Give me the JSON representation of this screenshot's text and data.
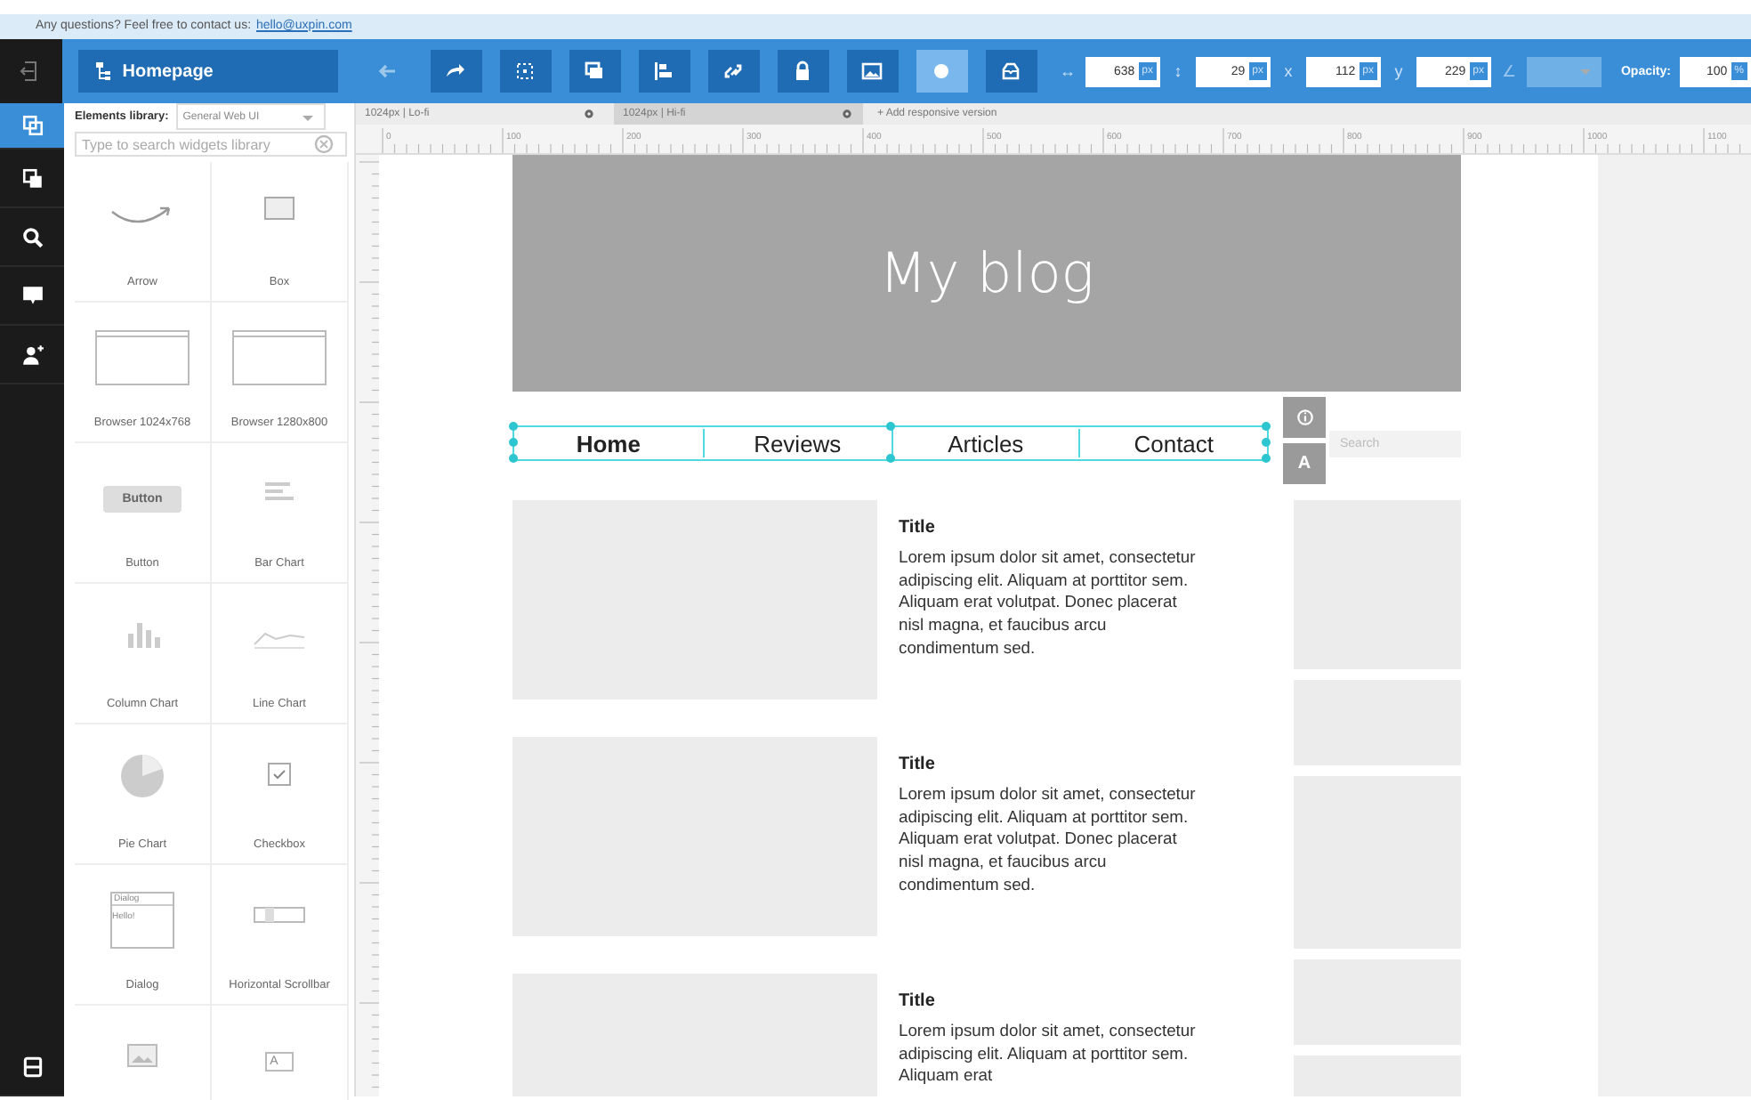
{
  "banner": {
    "text": "Any questions? Feel free to contact us:",
    "link": "hello@uxpin.com"
  },
  "toolbar": {
    "page": "Homepage",
    "tools": [
      {
        "kind": "undo",
        "selected": false,
        "disabled": true
      },
      {
        "kind": "redo",
        "selected": false,
        "disabled": false
      },
      {
        "kind": "group",
        "selected": false,
        "disabled": false
      },
      {
        "kind": "layers",
        "selected": false,
        "disabled": false
      },
      {
        "kind": "align",
        "selected": false,
        "disabled": false
      },
      {
        "kind": "link",
        "selected": false,
        "disabled": false
      },
      {
        "kind": "lock",
        "selected": false,
        "disabled": false
      },
      {
        "kind": "image",
        "selected": false,
        "disabled": false
      },
      {
        "kind": "circle",
        "selected": true,
        "disabled": false
      },
      {
        "kind": "tray",
        "selected": false,
        "disabled": false
      }
    ],
    "fields": [
      {
        "label": "↔",
        "value": "638",
        "unit": "px",
        "disabled": false
      },
      {
        "label": "↕",
        "value": "29",
        "unit": "px",
        "disabled": false
      },
      {
        "label": "x",
        "value": "112",
        "unit": "px",
        "disabled": false
      },
      {
        "label": "y",
        "value": "229",
        "unit": "px",
        "disabled": false
      },
      {
        "label": "∠",
        "disabled": true
      }
    ],
    "opacity": {
      "label": "Opacity:",
      "value": "100",
      "unit": "%"
    }
  },
  "rail": [
    {
      "kind": "copy",
      "selected": true
    },
    {
      "kind": "pages",
      "selected": false
    },
    {
      "kind": "search",
      "selected": false
    },
    {
      "kind": "comment",
      "selected": false
    },
    {
      "kind": "user",
      "selected": false
    }
  ],
  "library": {
    "label": "Elements library:",
    "dropdown": "General Web UI",
    "search_placeholder": "Type to search widgets library",
    "items": [
      {
        "kind": "arrow",
        "label": "Arrow"
      },
      {
        "kind": "box",
        "label": "Box"
      },
      {
        "kind": "browser",
        "label": "Browser 1024x768"
      },
      {
        "kind": "browser",
        "label": "Browser 1280x800"
      },
      {
        "kind": "button",
        "label": "Button",
        "preview": [
          "Button"
        ]
      },
      {
        "kind": "bar-chart",
        "label": "Bar Chart"
      },
      {
        "kind": "column-chart",
        "label": "Column Chart"
      },
      {
        "kind": "line-chart",
        "label": "Line Chart"
      },
      {
        "kind": "pie-chart",
        "label": "Pie Chart"
      },
      {
        "kind": "checkbox",
        "label": "Checkbox"
      },
      {
        "kind": "dialog",
        "label": "Dialog",
        "preview": [
          "Dialog",
          "Hello!"
        ]
      },
      {
        "kind": "scrollbar",
        "label": "Horizontal Scrollbar"
      },
      {
        "kind": "image"
      },
      {
        "kind": "text",
        "preview": [
          "A"
        ]
      }
    ]
  },
  "canvas": {
    "tabs": [
      {
        "label": "1024px | Lo-fi",
        "selected": false
      },
      {
        "label": "1024px | Hi-fi",
        "selected": true
      }
    ],
    "add_version": "+ Add responsive version",
    "ruler": [
      "0",
      "100",
      "200",
      "300",
      "400",
      "500",
      "600",
      "700",
      "800",
      "900",
      "1000",
      "1100"
    ],
    "blog": {
      "title": "My blog",
      "nav": [
        {
          "label": "Home",
          "selected": true
        },
        {
          "label": "Reviews",
          "selected": false
        },
        {
          "label": "Articles",
          "selected": false
        },
        {
          "label": "Contact",
          "selected": false
        }
      ],
      "side_buttons": [
        {
          "kind": "info"
        },
        {
          "kind": "text",
          "label": "A"
        }
      ],
      "search_placeholder": "Search",
      "posts": [
        {
          "title": "Title",
          "body": "Lorem ipsum dolor sit amet, consectetur adipiscing elit. Aliquam at porttitor sem. Aliquam erat volutpat. Donec placerat nisl magna, et faucibus arcu condimentum sed."
        },
        {
          "title": "Title",
          "body": "Lorem ipsum dolor sit amet, consectetur adipiscing elit. Aliquam at porttitor sem. Aliquam erat volutpat. Donec placerat nisl magna, et faucibus arcu condimentum sed."
        },
        {
          "title": "Title",
          "body": "Lorem ipsum dolor sit amet, consectetur adipiscing elit. Aliquam at porttitor sem. Aliquam erat"
        }
      ]
    }
  }
}
